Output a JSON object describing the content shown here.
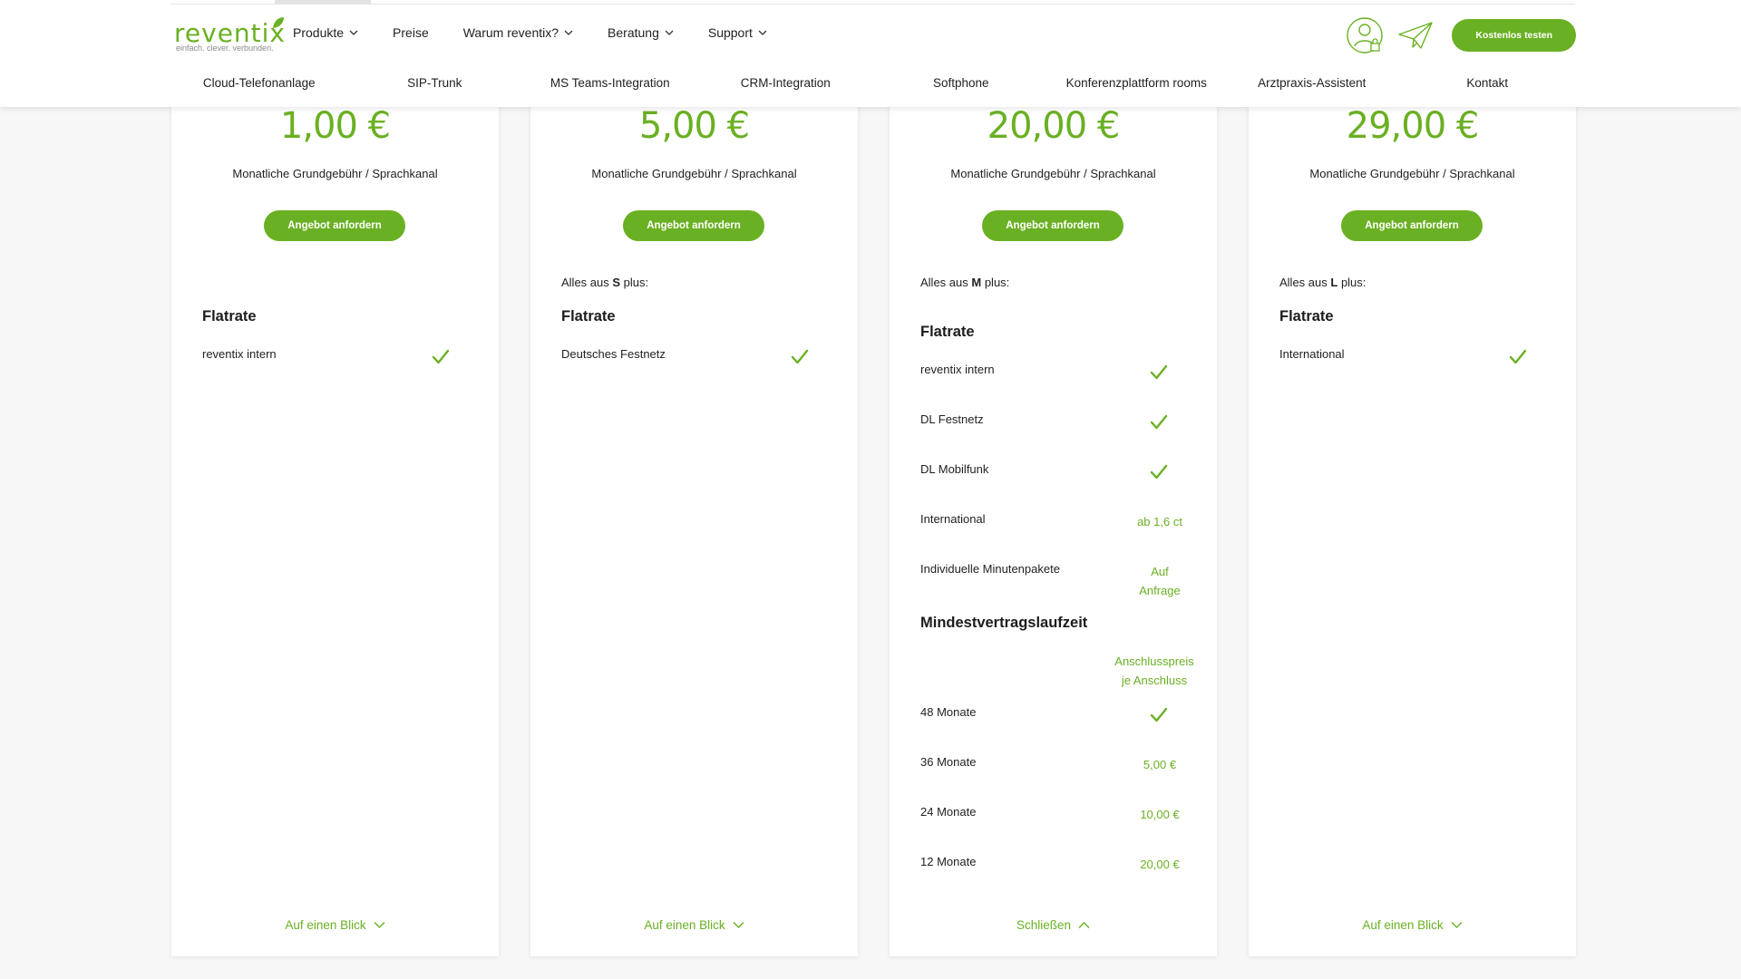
{
  "brand": {
    "name": "reventix",
    "tagline": "einfach. clever. verbunden.",
    "accent": "#6ab023"
  },
  "main_nav": [
    {
      "label": "Produkte",
      "dropdown": true
    },
    {
      "label": "Preise",
      "dropdown": false
    },
    {
      "label": "Warum reventix?",
      "dropdown": true
    },
    {
      "label": "Beratung",
      "dropdown": true
    },
    {
      "label": "Support",
      "dropdown": true
    }
  ],
  "header_actions": {
    "user_icon": "user-lock-icon",
    "send_icon": "paper-plane-icon",
    "cta_label": "Kostenlos testen"
  },
  "sub_nav": [
    "Cloud-Telefonanlage",
    "SIP-Trunk",
    "MS Teams-Integration",
    "CRM-Integration",
    "Softphone",
    "Konferenzplattform rooms",
    "Arztpraxis-Assistent",
    "Kontakt"
  ],
  "cards": [
    {
      "price": "1,00 €",
      "price_sub": "Monatliche Grundgebühr / Sprachkanal",
      "button": "Angebot anfordern",
      "section_title": "Flatrate",
      "rows": [
        {
          "label": "reventix intern",
          "check": true
        }
      ],
      "toggle": "Auf einen Blick"
    },
    {
      "price": "5,00 €",
      "price_sub": "Monatliche Grundgebühr / Sprachkanal",
      "button": "Angebot anfordern",
      "plus_prefix": "Alles aus ",
      "plus_tier": "S",
      "plus_suffix": " plus:",
      "section_title": "Flatrate",
      "rows": [
        {
          "label": "Deutsches Festnetz",
          "check": true
        }
      ],
      "toggle": "Auf einen Blick"
    },
    {
      "price": "20,00 €",
      "price_sub": "Monatliche Grundgebühr / Sprachkanal",
      "button": "Angebot anfordern",
      "plus_prefix": "Alles aus ",
      "plus_tier": "M",
      "plus_suffix": " plus:",
      "section_title": "Flatrate",
      "rows": [
        {
          "label": "reventix intern",
          "check": true
        },
        {
          "label": "DL Festnetz",
          "check": true
        },
        {
          "label": "DL Mobilfunk",
          "check": true
        },
        {
          "label": "International",
          "value": "ab 1,6 ct"
        },
        {
          "label": "Individuelle Minutenpakete",
          "value_line1": "Auf",
          "value_line2": "Anfrage"
        }
      ],
      "section2_title": "Mindestvertragslaufzeit",
      "column_head_line1": "Anschlusspreis",
      "column_head_line2": "je Anschluss",
      "contract_rows": [
        {
          "label": "48 Monate",
          "check": true
        },
        {
          "label": "36 Monate",
          "value": "5,00 €"
        },
        {
          "label": "24 Monate",
          "value": "10,00 €"
        },
        {
          "label": "12 Monate",
          "value": "20,00 €"
        }
      ],
      "toggle": "Schließen"
    },
    {
      "price": "29,00 €",
      "price_sub": "Monatliche Grundgebühr / Sprachkanal",
      "button": "Angebot anfordern",
      "plus_prefix": "Alles aus ",
      "plus_tier": "L",
      "plus_suffix": " plus:",
      "section_title": "Flatrate",
      "rows": [
        {
          "label": "International",
          "check": true
        }
      ],
      "toggle": "Auf einen Blick"
    }
  ]
}
